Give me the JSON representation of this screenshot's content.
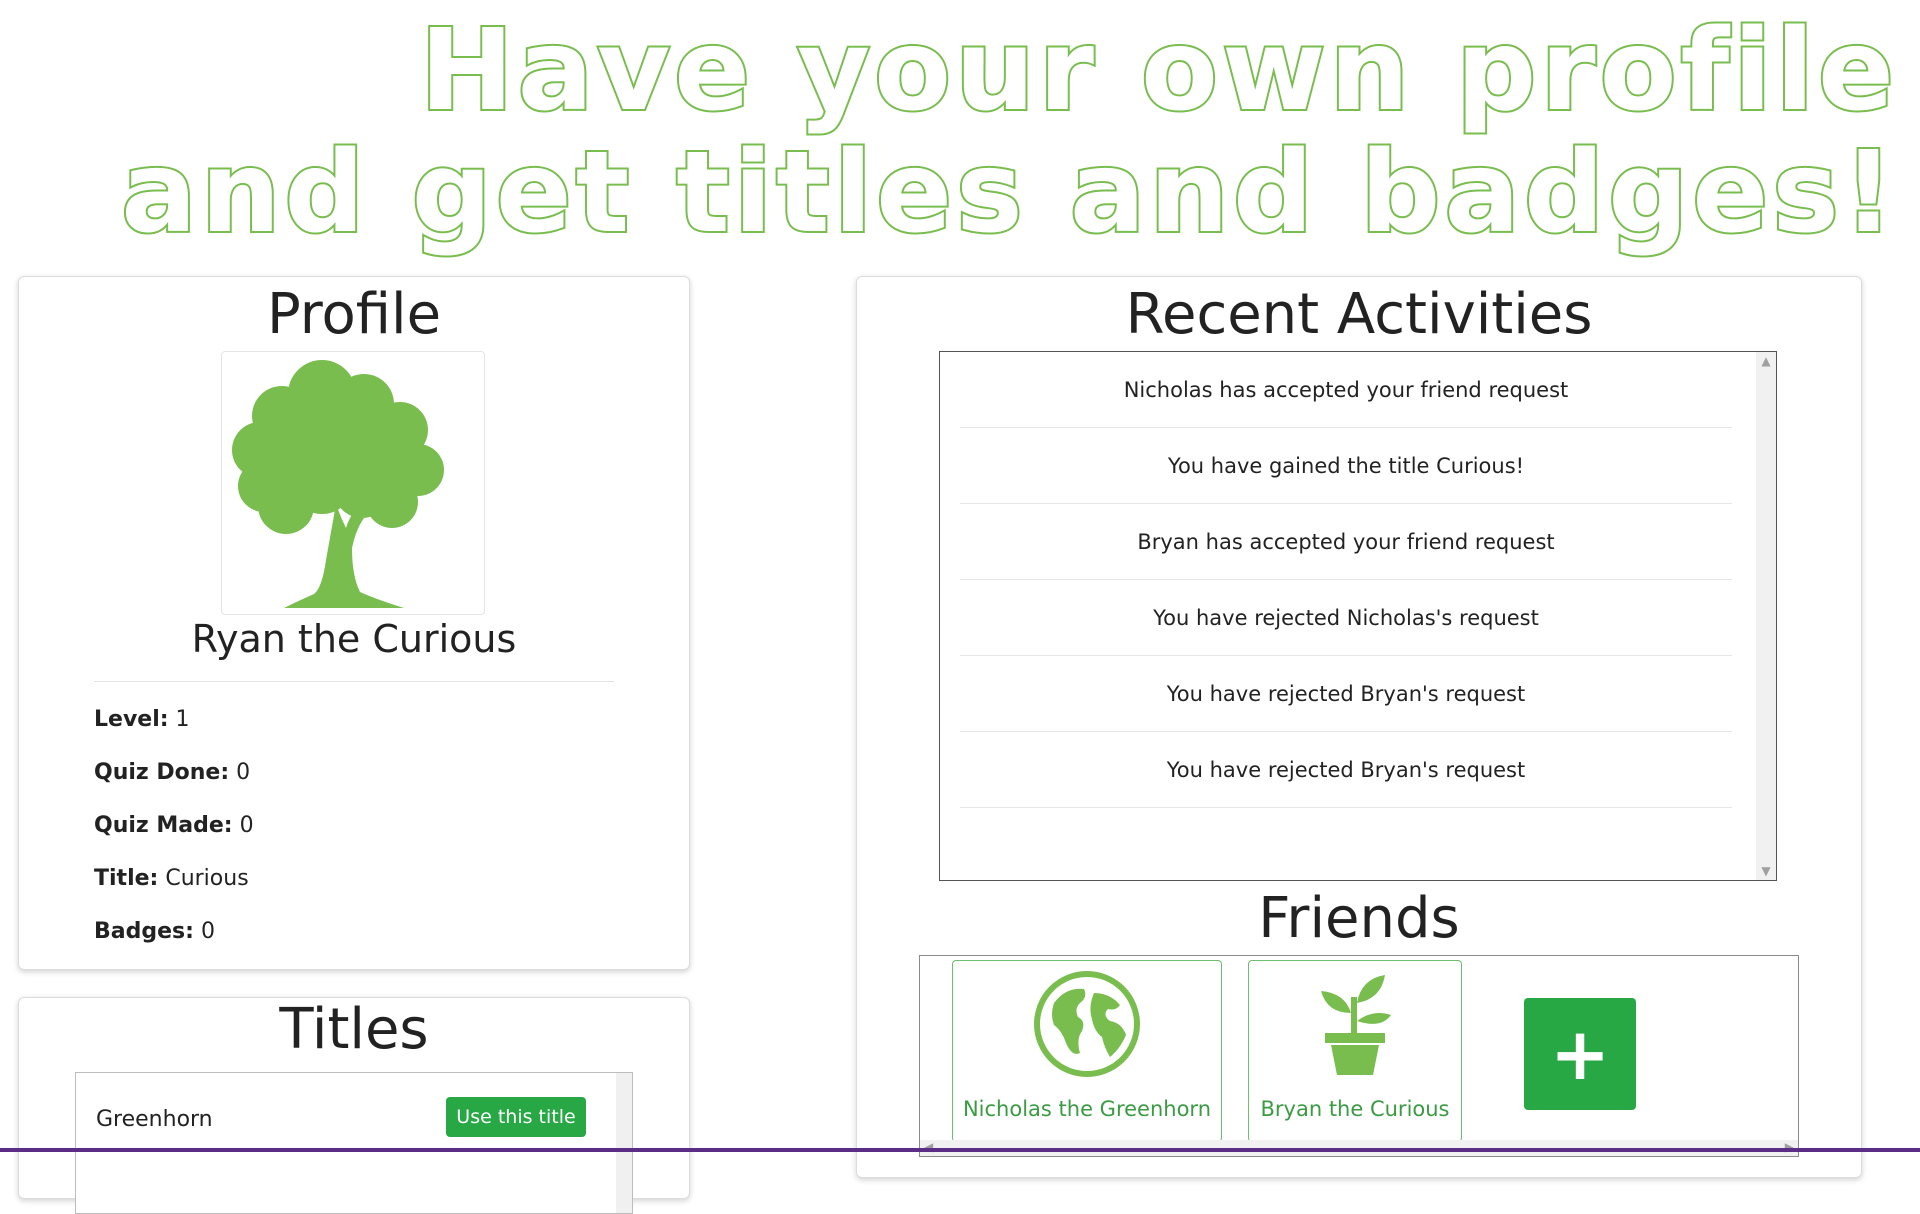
{
  "promo": {
    "line1": "Have your own profile",
    "line2": "and get titles and badges!"
  },
  "colors": {
    "accent_green": "#79bd4f",
    "button_green": "#28a745",
    "friend_text_green": "#3a9b43"
  },
  "profile": {
    "heading": "Profile",
    "avatar_icon": "tree-icon",
    "name": "Ryan the Curious",
    "stats": [
      {
        "label": "Level:",
        "value": "1"
      },
      {
        "label": "Quiz Done:",
        "value": "0"
      },
      {
        "label": "Quiz Made:",
        "value": "0"
      },
      {
        "label": "Title:",
        "value": "Curious"
      },
      {
        "label": "Badges:",
        "value": "0"
      }
    ]
  },
  "titles": {
    "heading": "Titles",
    "items": [
      {
        "name": "Greenhorn",
        "button_label": "Use this title"
      }
    ]
  },
  "activities": {
    "heading": "Recent Activities",
    "items": [
      "Nicholas has accepted your friend request",
      "You have gained the title Curious!",
      "Bryan has accepted your friend request",
      "You have rejected Nicholas's request",
      "You have rejected Bryan's request",
      "You have rejected Bryan's request"
    ]
  },
  "friends": {
    "heading": "Friends",
    "items": [
      {
        "name": "Nicholas the Greenhorn",
        "icon": "globe-icon"
      },
      {
        "name": "Bryan the Curious",
        "icon": "potted-plant-icon"
      }
    ],
    "add_label": "+"
  }
}
